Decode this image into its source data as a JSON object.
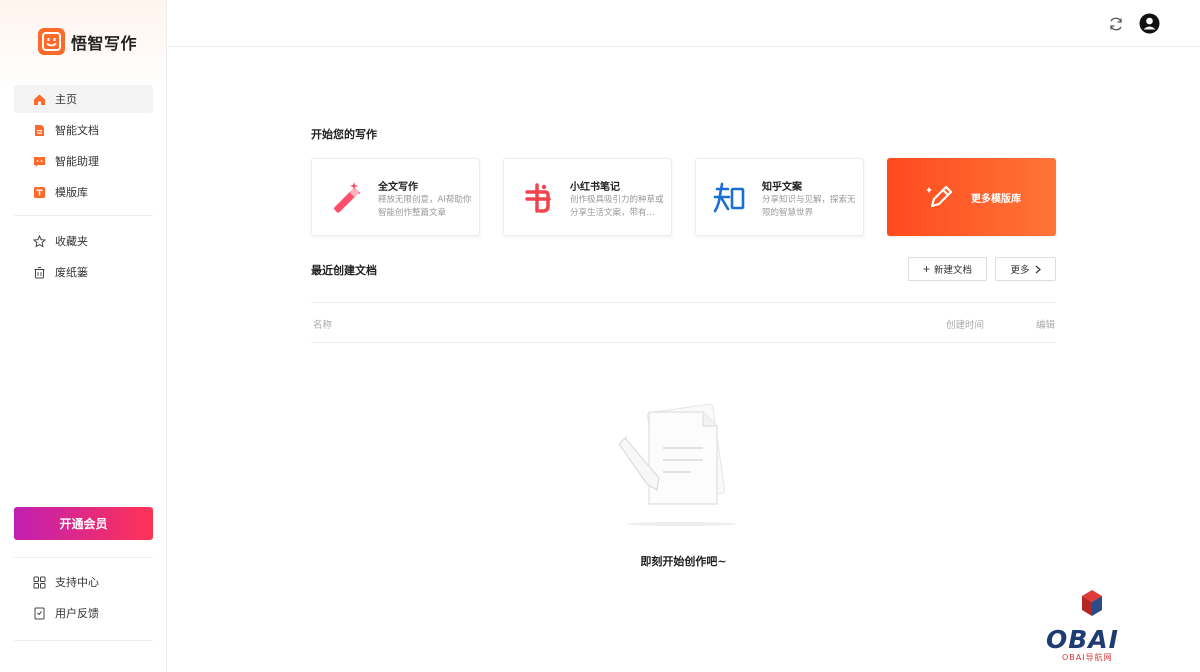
{
  "app": {
    "name": "悟智写作",
    "accent": "#ff6a2b"
  },
  "sidebar": {
    "primary": [
      {
        "label": "主页",
        "icon": "home-icon",
        "active": true
      },
      {
        "label": "智能文档",
        "icon": "document-icon"
      },
      {
        "label": "智能助理",
        "icon": "assistant-icon"
      },
      {
        "label": "模版库",
        "icon": "template-icon"
      }
    ],
    "secondary": [
      {
        "label": "收藏夹",
        "icon": "star-icon"
      },
      {
        "label": "废纸篓",
        "icon": "trash-icon"
      }
    ],
    "vip_label": "开通会员",
    "footer": [
      {
        "label": "支持中心",
        "icon": "grid-icon"
      },
      {
        "label": "用户反馈",
        "icon": "feedback-icon"
      }
    ]
  },
  "header": {
    "refresh_icon": "refresh-icon",
    "user_icon": "user-avatar-icon"
  },
  "main": {
    "start_title": "开始您的写作",
    "cards": [
      {
        "title": "全文写作",
        "desc": "释放无限创意，AI帮助你智能创作整篇文章",
        "icon": "magic-wand-icon"
      },
      {
        "title": "小红书笔记",
        "desc": "创作极具吸引力的种草或分享生活文案，带有...",
        "icon": "xiaohongshu-icon"
      },
      {
        "title": "知乎文案",
        "desc": "分享知识与见解，探索无限的智慧世界",
        "icon": "zhihu-icon"
      }
    ],
    "more_templates": "更多模版库",
    "recent_title": "最近创建文档",
    "new_doc": "新建文档",
    "more": "更多",
    "columns": {
      "name": "名称",
      "created": "创建时间",
      "edit": "编辑"
    },
    "empty_text": "即刻开始创作吧~"
  },
  "watermark": {
    "text": "OBAI",
    "sub": "OBAI导航网"
  }
}
